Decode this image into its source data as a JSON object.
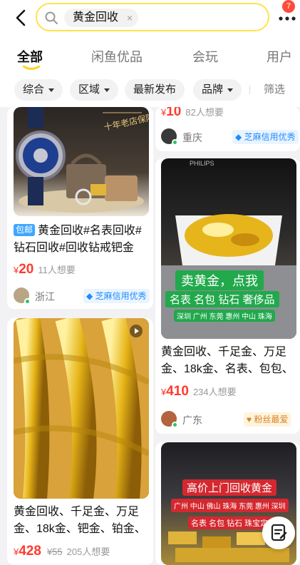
{
  "search": {
    "query": "黄金回收",
    "close_glyph": "×"
  },
  "header": {
    "badge_count": "7"
  },
  "tabs": [
    {
      "label": "全部"
    },
    {
      "label": "闲鱼优品"
    },
    {
      "label": "会玩"
    },
    {
      "label": "用户"
    }
  ],
  "filters": [
    {
      "label": "综合"
    },
    {
      "label": "区域"
    },
    {
      "label": "最新发布"
    },
    {
      "label": "品牌"
    }
  ],
  "filter_sort": "筛选",
  "left_column": [
    {
      "image_caption": "十年老店保障!",
      "pin": "包邮",
      "title": "黄金回收#名表回收#钻石回收#回收钻戒钯金",
      "price_currency": "¥",
      "price": "20",
      "want": "11人想要",
      "location": "浙江",
      "credit": "芝麻信用优秀"
    },
    {
      "title": "黄金回收、千足金、万足金、18k金、钯金、铂金、",
      "price_currency": "¥",
      "price": "428",
      "old_price": "¥55",
      "want": "205人想要"
    }
  ],
  "right_column": [
    {
      "price_currency": "¥",
      "price": "10",
      "want": "82人想要",
      "location": "重庆",
      "credit": "芝麻信用优秀"
    },
    {
      "image_brand": "PHILIPS",
      "image_line1": "卖黄金，点我",
      "image_line2": "名表 名包 钻石 奢侈品",
      "image_line3": "深圳 广州 东莞 惠州 中山 珠海",
      "title": "黄金回收、千足金、万足金、18k金、名表、包包、",
      "price_currency": "¥",
      "price": "410",
      "want": "234人想要",
      "location": "广东",
      "fans": "粉丝最爱"
    },
    {
      "image_line1": "高价上门回收黄金",
      "image_line2": "广州 中山 佛山 珠海 东莞 惠州 深圳",
      "image_line3": "名表 名包 钻石 珠宝定制"
    }
  ],
  "colors": {
    "accent": "#ffe24a",
    "price": "#ff3a2e",
    "credit": "#1f8bff"
  }
}
